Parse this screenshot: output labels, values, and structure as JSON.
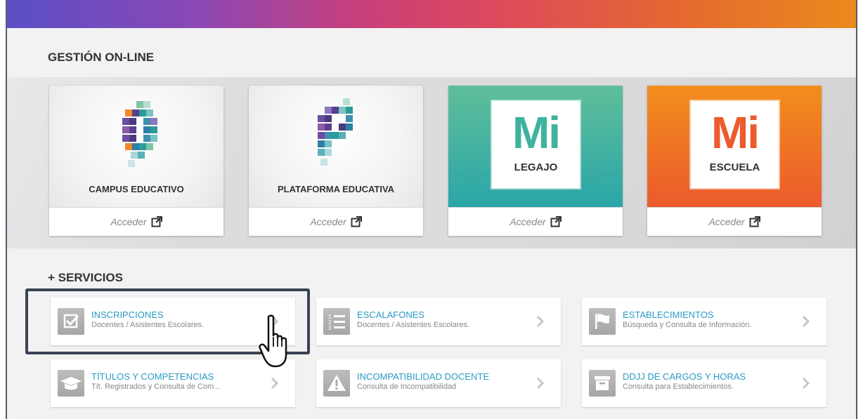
{
  "sections": {
    "online_title": "GESTIÓN ON-LINE",
    "services_title": "+ SERVICIOS"
  },
  "cards": [
    {
      "label": "CAMPUS EDUCATIVO",
      "access": "Acceder",
      "icon": "campus-logo-icon"
    },
    {
      "label": "PLATAFORMA EDUCATIVA",
      "access": "Acceder",
      "icon": "plataforma-logo-icon"
    },
    {
      "logo": "Mi",
      "sub": "LEGAJO",
      "access": "Acceder",
      "color": "#3fb39d"
    },
    {
      "logo": "Mi",
      "sub": "ESCUELA",
      "access": "Acceder",
      "color": "#ec5a2d"
    }
  ],
  "services": [
    {
      "title": "INSCRIPCIONES",
      "subtitle": "Docentes / Asistentes Escolares.",
      "icon": "checkbox-icon"
    },
    {
      "title": "ESCALAFONES",
      "subtitle": "Docentes / Asistentes Escolares.",
      "icon": "numbered-list-icon"
    },
    {
      "title": "ESTABLECIMIENTOS",
      "subtitle": "Búsqueda y Consulta de Información.",
      "icon": "flag-icon"
    },
    {
      "title": "TÍTULOS Y COMPETENCIAS",
      "subtitle": "Tít. Registrados y Consulta de Com...",
      "icon": "graduation-cap-icon"
    },
    {
      "title": "INCOMPATIBILIDAD DOCENTE",
      "subtitle": "Consulta de Incompatibilidad",
      "icon": "warning-icon"
    },
    {
      "title": "DDJJ DE CARGOS Y HORAS",
      "subtitle": "Consulta para Establecimientos.",
      "icon": "archive-box-icon"
    }
  ],
  "colors": {
    "link_blue": "#2a9bc4",
    "highlight_border": "#3b4353"
  }
}
